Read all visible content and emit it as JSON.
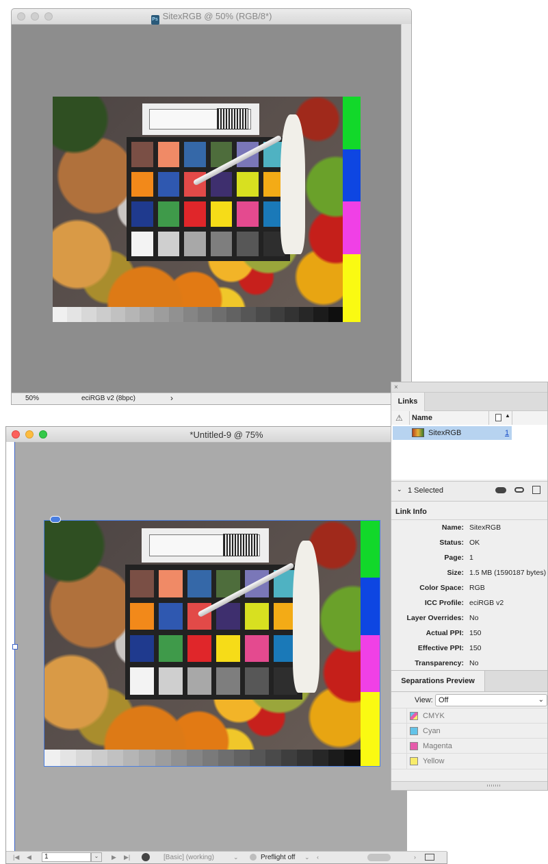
{
  "ps_window": {
    "title": "SitexRGB @ 50% (RGB/8*)",
    "doc_icon": "Ps",
    "zoom": "50%",
    "profile": "eciRGB v2 (8bpc)",
    "status_arrow": "›"
  },
  "id_window": {
    "title": "*Untitled-9 @ 75%",
    "page_number": "1",
    "style_mode": "[Basic] (working)",
    "preflight": "Preflight off"
  },
  "links_panel": {
    "tab_label": "Links",
    "close_glyph": "×",
    "col_name": "Name",
    "link_name": "SitexRGB",
    "link_page": "1",
    "selected_label": "1 Selected",
    "link_info_title": "Link Info",
    "info": [
      {
        "key": "Name:",
        "value": "SitexRGB"
      },
      {
        "key": "Status:",
        "value": "OK"
      },
      {
        "key": "Page:",
        "value": "1"
      },
      {
        "key": "Size:",
        "value": "1.5 MB (1590187 bytes)"
      },
      {
        "key": "Color Space:",
        "value": "RGB"
      },
      {
        "key": "ICC Profile:",
        "value": "eciRGB v2"
      },
      {
        "key": "Layer Overrides:",
        "value": "No"
      },
      {
        "key": "Actual PPI:",
        "value": "150"
      },
      {
        "key": "Effective PPI:",
        "value": "150"
      },
      {
        "key": "Transparency:",
        "value": "No"
      }
    ]
  },
  "separations_panel": {
    "tab_label": "Separations Preview",
    "view_label": "View:",
    "view_value": "Off",
    "rows": [
      {
        "label": "CMYK",
        "color": "#b0a0d0"
      },
      {
        "label": "Cyan",
        "color": "#63c3e8"
      },
      {
        "label": "Magenta",
        "color": "#e65bab"
      },
      {
        "label": "Yellow",
        "color": "#f8ec6a"
      }
    ]
  },
  "image_colors": {
    "patches": [
      "#7a4f45",
      "#f08a66",
      "#3568a8",
      "#4e6d3c",
      "#7a77b8",
      "#4fb2c2",
      "#f2891a",
      "#2f58b0",
      "#e24a48",
      "#3e2f6e",
      "#d8e020",
      "#f3ab16",
      "#1f3a8e",
      "#3f9a4a",
      "#e0262a",
      "#f6dc18",
      "#e44a8f",
      "#1a79b8",
      "#f3f3f3",
      "#cfcfcf",
      "#a8a8a8",
      "#7e7e7e",
      "#575757",
      "#2e2e2e"
    ],
    "side_bars": [
      "#12d82a",
      "#0e46e2",
      "#f040e6",
      "#fafa12"
    ]
  }
}
